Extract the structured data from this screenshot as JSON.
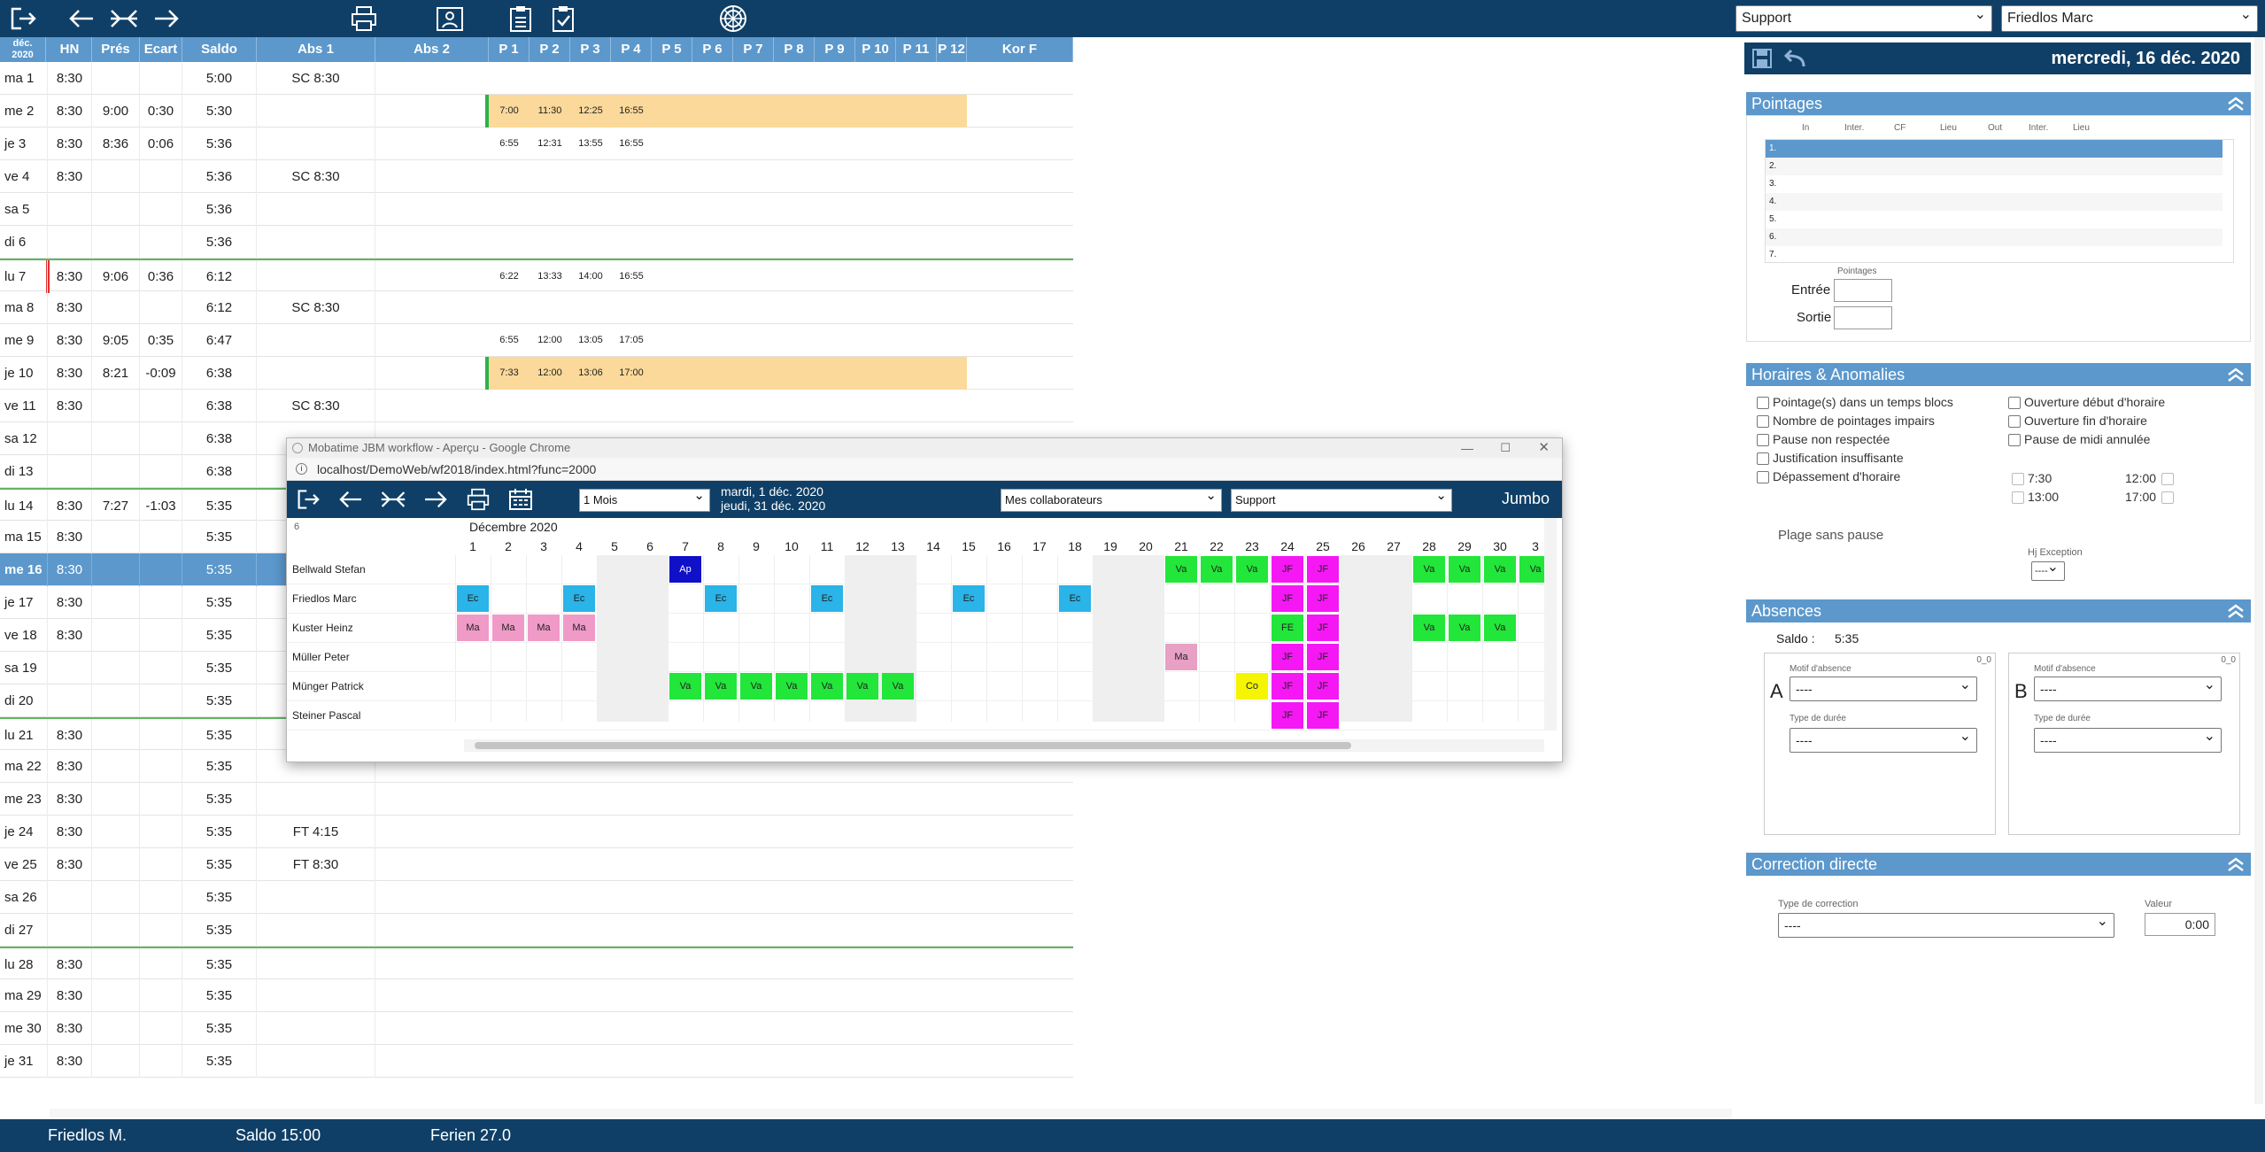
{
  "topbar": {
    "select_group": "Support",
    "select_person": "Friedlos Marc"
  },
  "grid": {
    "head_month": "déc.",
    "head_year": "2020",
    "columns": [
      "HN",
      "Prés",
      "Ecart",
      "Saldo",
      "Abs 1",
      "Abs 2",
      "P 1",
      "P 2",
      "P 3",
      "P 4",
      "P 5",
      "P 6",
      "P 7",
      "P 8",
      "P 9",
      "P 10",
      "P 11",
      "P 12",
      "Kor F"
    ],
    "rows": [
      {
        "day": "ma  1",
        "hn": "8:30",
        "pres": "",
        "ecart": "",
        "saldo": "5:00",
        "abs1": "SC 8:30",
        "p": []
      },
      {
        "day": "me  2",
        "hn": "8:30",
        "pres": "9:00",
        "ecart": "0:30",
        "saldo": "5:30",
        "abs1": "",
        "p": [
          "7:00",
          "11:30",
          "12:25",
          "16:55"
        ],
        "plan": true
      },
      {
        "day": "je  3",
        "hn": "8:30",
        "pres": "8:36",
        "ecart": "0:06",
        "saldo": "5:36",
        "abs1": "",
        "p": [
          "6:55",
          "12:31",
          "13:55",
          "16:55"
        ]
      },
      {
        "day": "ve  4",
        "hn": "8:30",
        "pres": "",
        "ecart": "",
        "saldo": "5:36",
        "abs1": "SC 8:30",
        "p": []
      },
      {
        "day": "sa  5",
        "hn": "",
        "pres": "",
        "ecart": "",
        "saldo": "5:36",
        "abs1": "",
        "p": []
      },
      {
        "day": "di  6",
        "hn": "",
        "pres": "",
        "ecart": "",
        "saldo": "5:36",
        "abs1": "",
        "p": []
      },
      {
        "day": "lu  7",
        "hn": "8:30",
        "pres": "9:06",
        "ecart": "0:36",
        "saldo": "6:12",
        "abs1": "",
        "p": [
          "6:22",
          "13:33",
          "14:00",
          "16:55"
        ],
        "redmark": true,
        "weeksep": true
      },
      {
        "day": "ma  8",
        "hn": "8:30",
        "pres": "",
        "ecart": "",
        "saldo": "6:12",
        "abs1": "SC 8:30",
        "p": []
      },
      {
        "day": "me  9",
        "hn": "8:30",
        "pres": "9:05",
        "ecart": "0:35",
        "saldo": "6:47",
        "abs1": "",
        "p": [
          "6:55",
          "12:00",
          "13:05",
          "17:05"
        ]
      },
      {
        "day": "je 10",
        "hn": "8:30",
        "pres": "8:21",
        "ecart": "-0:09",
        "saldo": "6:38",
        "abs1": "",
        "p": [
          "7:33",
          "12:00",
          "13:06",
          "17:00"
        ],
        "plan": true
      },
      {
        "day": "ve 11",
        "hn": "8:30",
        "pres": "",
        "ecart": "",
        "saldo": "6:38",
        "abs1": "SC 8:30",
        "p": []
      },
      {
        "day": "sa 12",
        "hn": "",
        "pres": "",
        "ecart": "",
        "saldo": "6:38",
        "abs1": "",
        "p": []
      },
      {
        "day": "di 13",
        "hn": "",
        "pres": "",
        "ecart": "",
        "saldo": "6:38",
        "abs1": "",
        "p": []
      },
      {
        "day": "lu 14",
        "hn": "8:30",
        "pres": "7:27",
        "ecart": "-1:03",
        "saldo": "5:35",
        "abs1": "",
        "p": [],
        "weeksep": true
      },
      {
        "day": "ma 15",
        "hn": "8:30",
        "pres": "",
        "ecart": "",
        "saldo": "5:35",
        "abs1": "",
        "p": []
      },
      {
        "day": "me 16",
        "hn": "8:30",
        "pres": "",
        "ecart": "",
        "saldo": "5:35",
        "abs1": "",
        "p": [],
        "selected": true
      },
      {
        "day": "je 17",
        "hn": "8:30",
        "pres": "",
        "ecart": "",
        "saldo": "5:35",
        "abs1": "",
        "p": []
      },
      {
        "day": "ve 18",
        "hn": "8:30",
        "pres": "",
        "ecart": "",
        "saldo": "5:35",
        "abs1": "",
        "p": []
      },
      {
        "day": "sa 19",
        "hn": "",
        "pres": "",
        "ecart": "",
        "saldo": "5:35",
        "abs1": "",
        "p": []
      },
      {
        "day": "di 20",
        "hn": "",
        "pres": "",
        "ecart": "",
        "saldo": "5:35",
        "abs1": "",
        "p": []
      },
      {
        "day": "lu 21",
        "hn": "8:30",
        "pres": "",
        "ecart": "",
        "saldo": "5:35",
        "abs1": "",
        "p": [],
        "weeksep": true
      },
      {
        "day": "ma 22",
        "hn": "8:30",
        "pres": "",
        "ecart": "",
        "saldo": "5:35",
        "abs1": "",
        "p": []
      },
      {
        "day": "me 23",
        "hn": "8:30",
        "pres": "",
        "ecart": "",
        "saldo": "5:35",
        "abs1": "",
        "p": []
      },
      {
        "day": "je 24",
        "hn": "8:30",
        "pres": "",
        "ecart": "",
        "saldo": "5:35",
        "abs1": "FT 4:15",
        "p": []
      },
      {
        "day": "ve 25",
        "hn": "8:30",
        "pres": "",
        "ecart": "",
        "saldo": "5:35",
        "abs1": "FT 8:30",
        "p": []
      },
      {
        "day": "sa 26",
        "hn": "",
        "pres": "",
        "ecart": "",
        "saldo": "5:35",
        "abs1": "",
        "p": []
      },
      {
        "day": "di 27",
        "hn": "",
        "pres": "",
        "ecart": "",
        "saldo": "5:35",
        "abs1": "",
        "p": []
      },
      {
        "day": "lu 28",
        "hn": "8:30",
        "pres": "",
        "ecart": "",
        "saldo": "5:35",
        "abs1": "",
        "p": [],
        "weeksep": true
      },
      {
        "day": "ma 29",
        "hn": "8:30",
        "pres": "",
        "ecart": "",
        "saldo": "5:35",
        "abs1": "",
        "p": []
      },
      {
        "day": "me 30",
        "hn": "8:30",
        "pres": "",
        "ecart": "",
        "saldo": "5:35",
        "abs1": "",
        "p": []
      },
      {
        "day": "je 31",
        "hn": "8:30",
        "pres": "",
        "ecart": "",
        "saldo": "5:35",
        "abs1": "",
        "p": []
      }
    ]
  },
  "right": {
    "date": "mercredi, 16 déc. 2020",
    "pointages": {
      "title": "Pointages",
      "cols": [
        "In",
        "Inter.",
        "CF",
        "Lieu",
        "Out",
        "Inter.",
        "Lieu"
      ],
      "rows": [
        "1.",
        "2.",
        "3.",
        "4.",
        "5.",
        "6.",
        "7."
      ],
      "sub_label": "Pointages",
      "entree": "Entrée",
      "sortie": "Sortie"
    },
    "horaires": {
      "title": "Horaires & Anomalies",
      "left": [
        "Pointage(s) dans un temps blocs",
        "Nombre de pointages impairs",
        "Pause non respectée",
        "Justification insuffisante",
        "Dépassement d'horaire"
      ],
      "right": [
        "Ouverture début d'horaire",
        "Ouverture fin d'horaire",
        "Pause de midi annulée"
      ],
      "times": [
        "7:30",
        "12:00",
        "13:00",
        "17:00"
      ],
      "plage": "Plage sans pause",
      "hj_label": "Hj Exception",
      "hj_value": "----"
    },
    "absences": {
      "title": "Absences",
      "saldo_label": "Saldo :",
      "saldo_value": "5:35",
      "a_letter": "A",
      "b_letter": "B",
      "counter": "0_0",
      "motif_label": "Motif d'absence",
      "duree_label": "Type de durée",
      "empty": "----"
    },
    "correction": {
      "title": "Correction directe",
      "type_label": "Type de correction",
      "type_value": "----",
      "valeur_label": "Valeur",
      "valeur_value": "0:00"
    }
  },
  "popup": {
    "title": "Mobatime JBM workflow - Aperçu - Google Chrome",
    "url": "localhost/DemoWeb/wf2018/index.html?func=2000",
    "period": "1 Mois",
    "date_from": "mardi, 1 déc. 2020",
    "date_to": "jeudi, 31 déc. 2020",
    "collab": "Mes collaborateurs",
    "group": "Support",
    "jumbo": "Jumbo",
    "week": "6",
    "month": "Décembre 2020",
    "days": [
      "1",
      "2",
      "3",
      "4",
      "5",
      "6",
      "7",
      "8",
      "9",
      "10",
      "11",
      "12",
      "13",
      "14",
      "15",
      "16",
      "17",
      "18",
      "19",
      "20",
      "21",
      "22",
      "23",
      "24",
      "25",
      "26",
      "27",
      "28",
      "29",
      "30",
      "3"
    ],
    "employees": [
      "Bellwald Stefan",
      "Friedlos Marc",
      "Kuster Heinz",
      "Müller Peter",
      "Münger Patrick",
      "Steiner Pascal"
    ],
    "blocks": [
      {
        "emp": 0,
        "day": 7,
        "label": "Ap",
        "color": "#1010c8",
        "fg": "#fff"
      },
      {
        "emp": 0,
        "day": 21,
        "label": "Va",
        "color": "#22e63a"
      },
      {
        "emp": 0,
        "day": 22,
        "label": "Va",
        "color": "#22e63a"
      },
      {
        "emp": 0,
        "day": 23,
        "label": "Va",
        "color": "#22e63a"
      },
      {
        "emp": 0,
        "day": 24,
        "label": "JF",
        "color": "#f518f5"
      },
      {
        "emp": 0,
        "day": 25,
        "label": "JF",
        "color": "#f518f5"
      },
      {
        "emp": 0,
        "day": 28,
        "label": "Va",
        "color": "#22e63a"
      },
      {
        "emp": 0,
        "day": 29,
        "label": "Va",
        "color": "#22e63a"
      },
      {
        "emp": 0,
        "day": 30,
        "label": "Va",
        "color": "#22e63a"
      },
      {
        "emp": 0,
        "day": 31,
        "label": "Va",
        "color": "#22e63a"
      },
      {
        "emp": 1,
        "day": 1,
        "label": "Ec",
        "color": "#2ab4e8"
      },
      {
        "emp": 1,
        "day": 4,
        "label": "Ec",
        "color": "#2ab4e8"
      },
      {
        "emp": 1,
        "day": 8,
        "label": "Ec",
        "color": "#2ab4e8"
      },
      {
        "emp": 1,
        "day": 11,
        "label": "Ec",
        "color": "#2ab4e8"
      },
      {
        "emp": 1,
        "day": 15,
        "label": "Ec",
        "color": "#2ab4e8"
      },
      {
        "emp": 1,
        "day": 18,
        "label": "Ec",
        "color": "#2ab4e8"
      },
      {
        "emp": 1,
        "day": 24,
        "label": "JF",
        "color": "#f518f5"
      },
      {
        "emp": 1,
        "day": 25,
        "label": "JF",
        "color": "#f518f5"
      },
      {
        "emp": 2,
        "day": 1,
        "label": "Ma",
        "color": "#f09ac8"
      },
      {
        "emp": 2,
        "day": 2,
        "label": "Ma",
        "color": "#f09ac8"
      },
      {
        "emp": 2,
        "day": 3,
        "label": "Ma",
        "color": "#f09ac8"
      },
      {
        "emp": 2,
        "day": 4,
        "label": "Ma",
        "color": "#f09ac8"
      },
      {
        "emp": 2,
        "day": 24,
        "label": "FE",
        "color": "#22e63a"
      },
      {
        "emp": 2,
        "day": 25,
        "label": "JF",
        "color": "#f518f5"
      },
      {
        "emp": 2,
        "day": 28,
        "label": "Va",
        "color": "#22e63a"
      },
      {
        "emp": 2,
        "day": 29,
        "label": "Va",
        "color": "#22e63a"
      },
      {
        "emp": 2,
        "day": 30,
        "label": "Va",
        "color": "#22e63a"
      },
      {
        "emp": 3,
        "day": 21,
        "label": "Ma",
        "color": "#e8a0c4"
      },
      {
        "emp": 3,
        "day": 24,
        "label": "JF",
        "color": "#f518f5"
      },
      {
        "emp": 3,
        "day": 25,
        "label": "JF",
        "color": "#f518f5"
      },
      {
        "emp": 4,
        "day": 7,
        "label": "Va",
        "color": "#22e63a"
      },
      {
        "emp": 4,
        "day": 8,
        "label": "Va",
        "color": "#22e63a"
      },
      {
        "emp": 4,
        "day": 9,
        "label": "Va",
        "color": "#22e63a"
      },
      {
        "emp": 4,
        "day": 10,
        "label": "Va",
        "color": "#22e63a"
      },
      {
        "emp": 4,
        "day": 11,
        "label": "Va",
        "color": "#22e63a"
      },
      {
        "emp": 4,
        "day": 12,
        "label": "Va",
        "color": "#22e63a"
      },
      {
        "emp": 4,
        "day": 13,
        "label": "Va",
        "color": "#22e63a"
      },
      {
        "emp": 4,
        "day": 23,
        "label": "Co",
        "color": "#f5f500"
      },
      {
        "emp": 4,
        "day": 24,
        "label": "JF",
        "color": "#f518f5"
      },
      {
        "emp": 4,
        "day": 25,
        "label": "JF",
        "color": "#f518f5"
      },
      {
        "emp": 5,
        "day": 24,
        "label": "JF",
        "color": "#f518f5"
      },
      {
        "emp": 5,
        "day": 25,
        "label": "JF",
        "color": "#f518f5"
      }
    ]
  },
  "status": {
    "name": "Friedlos M.",
    "saldo": "Saldo 15:00",
    "ferien": "Ferien 27.0"
  },
  "colors": {
    "navy": "#0f3f66",
    "header_blue": "#5c98cc",
    "plan_orange": "#fbd99a",
    "week_green": "#61b561"
  }
}
